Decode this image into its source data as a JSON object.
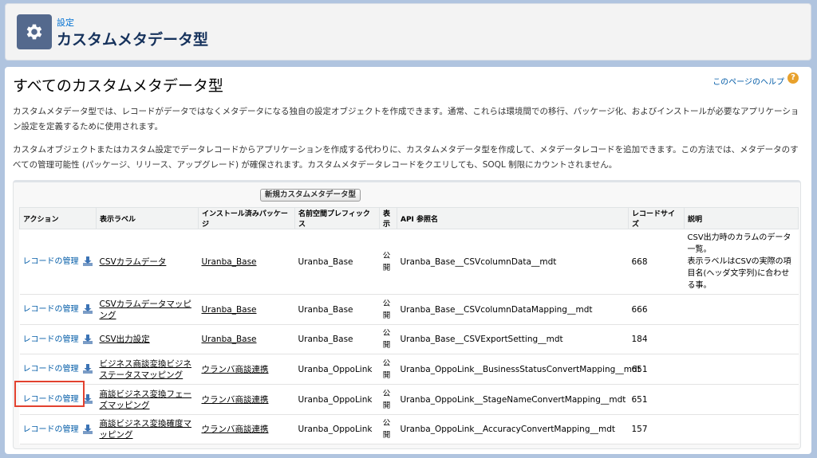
{
  "header": {
    "subtitle": "設定",
    "title": "カスタムメタデータ型",
    "icon": "gear-icon"
  },
  "page": {
    "title": "すべてのカスタムメタデータ型",
    "help_link": "このページのヘルプ",
    "description_1": "カスタムメタデータ型では、レコードがデータではなくメタデータになる独自の設定オブジェクトを作成できます。通常、これらは環境間での移行、パッケージ化、およびインストールが必要なアプリケーション設定を定義するために使用されます。",
    "description_2": "カスタムオブジェクトまたはカスタム設定でデータレコードからアプリケーションを作成する代わりに、カスタムメタデータ型を作成して、メタデータレコードを追加できます。この方法では、メタデータのすべての管理可能性 (パッケージ、リリース、アップグレード) が確保されます。カスタムメタデータレコードをクエリしても、SOQL 制限にカウントされません。"
  },
  "list": {
    "new_button": "新規カスタムメタデータ型",
    "columns": [
      "アクション",
      "表示ラベル",
      "インストール済みパッケージ",
      "名前空間プレフィックス",
      "表示",
      "API 参照名",
      "レコードサイズ",
      "説明"
    ],
    "rows": [
      {
        "action": "レコードの管理",
        "label": "CSVカラムデータ",
        "package": "Uranba_Base",
        "namespace": "Uranba_Base",
        "visibility": "公開",
        "api_name": "Uranba_Base__CSVcolumnData__mdt",
        "record_size": "668",
        "description": "CSV出力時のカラムのデータ一覧。\n表示ラベルはCSVの実際の項目名(ヘッダ文字列)に合わせる事。"
      },
      {
        "action": "レコードの管理",
        "label": "CSVカラムデータマッピング",
        "package": "Uranba_Base",
        "namespace": "Uranba_Base",
        "visibility": "公開",
        "api_name": "Uranba_Base__CSVcolumnDataMapping__mdt",
        "record_size": "666",
        "description": ""
      },
      {
        "action": "レコードの管理",
        "label": "CSV出力設定",
        "package": "Uranba_Base",
        "namespace": "Uranba_Base",
        "visibility": "公開",
        "api_name": "Uranba_Base__CSVExportSetting__mdt",
        "record_size": "184",
        "description": ""
      },
      {
        "action": "レコードの管理",
        "label": "ビジネス商談変換ビジネステータスマッピング",
        "package": "ウランバ商談連携",
        "namespace": "Uranba_OppoLink",
        "visibility": "公開",
        "api_name": "Uranba_OppoLink__BusinessStatusConvertMapping__mdt",
        "record_size": "651",
        "description": ""
      },
      {
        "action": "レコードの管理",
        "label": "商談ビジネス変換フェーズマッピング",
        "package": "ウランバ商談連携",
        "namespace": "Uranba_OppoLink",
        "visibility": "公開",
        "api_name": "Uranba_OppoLink__StageNameConvertMapping__mdt",
        "record_size": "651",
        "description": ""
      },
      {
        "action": "レコードの管理",
        "label": "商談ビジネス変換確度マッピング",
        "package": "ウランバ商談連携",
        "namespace": "Uranba_OppoLink",
        "visibility": "公開",
        "api_name": "Uranba_OppoLink__AccuracyConvertMapping__mdt",
        "record_size": "157",
        "description": ""
      }
    ]
  },
  "colors": {
    "background": "#b0c4df",
    "link": "#015ba7",
    "highlight": "#e2412f"
  }
}
